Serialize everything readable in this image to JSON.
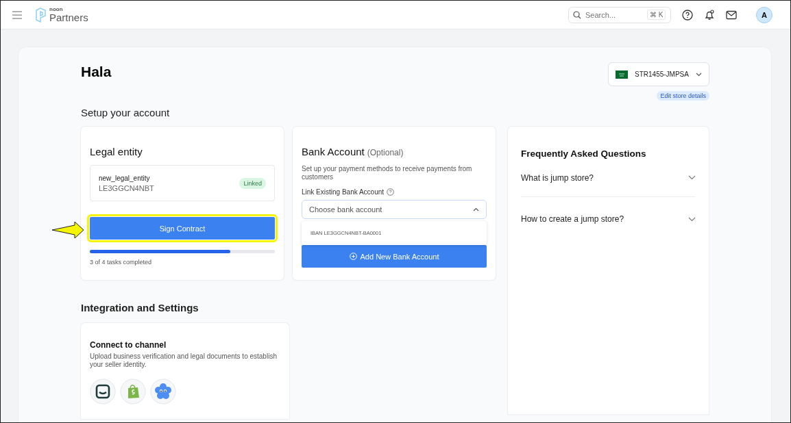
{
  "header": {
    "logo_top": "noon",
    "logo_bottom": "Partners",
    "search": {
      "placeholder": "Search...",
      "shortcut": "⌘ K"
    },
    "avatar": "A"
  },
  "page": {
    "greeting": "Hala",
    "store": {
      "code": "STR1455-JMPSA",
      "edit_link": "Edit store details"
    },
    "section_title": "Setup your account"
  },
  "legal_entity": {
    "title": "Legal entity",
    "entity_name": "new_legal_entity",
    "entity_id": "LE3GGCN4NBT",
    "status": "Linked",
    "button": "Sign Contract",
    "button_highlighted": true,
    "level": 0.76,
    "progress_text": "3 of 4 tasks completed"
  },
  "bank_account": {
    "title": "Bank Account",
    "title_note": "(Optional)",
    "description": "Set up your payment methods to receive payments from customers",
    "field_label": "Link Existing Bank Account",
    "dropdown": {
      "placeholder": "Choose bank account",
      "expanded": true,
      "options": [
        "IBAN LE3GGCN4NBT-BA0001"
      ]
    },
    "button": "Add New Bank Account"
  },
  "faq": {
    "title": "Frequently Asked Questions",
    "items": [
      {
        "question": "What is jump store?",
        "expanded": false
      },
      {
        "question": "How to create a jump store?",
        "expanded": false
      }
    ]
  },
  "integration": {
    "title": "Integration and Settings",
    "card_title": "Connect to channel",
    "card_text": "Upload business verification and legal documents to establish your seller identity.",
    "channels": [
      {
        "kind": "tray"
      },
      {
        "kind": "bag"
      },
      {
        "kind": "flower"
      }
    ]
  }
}
